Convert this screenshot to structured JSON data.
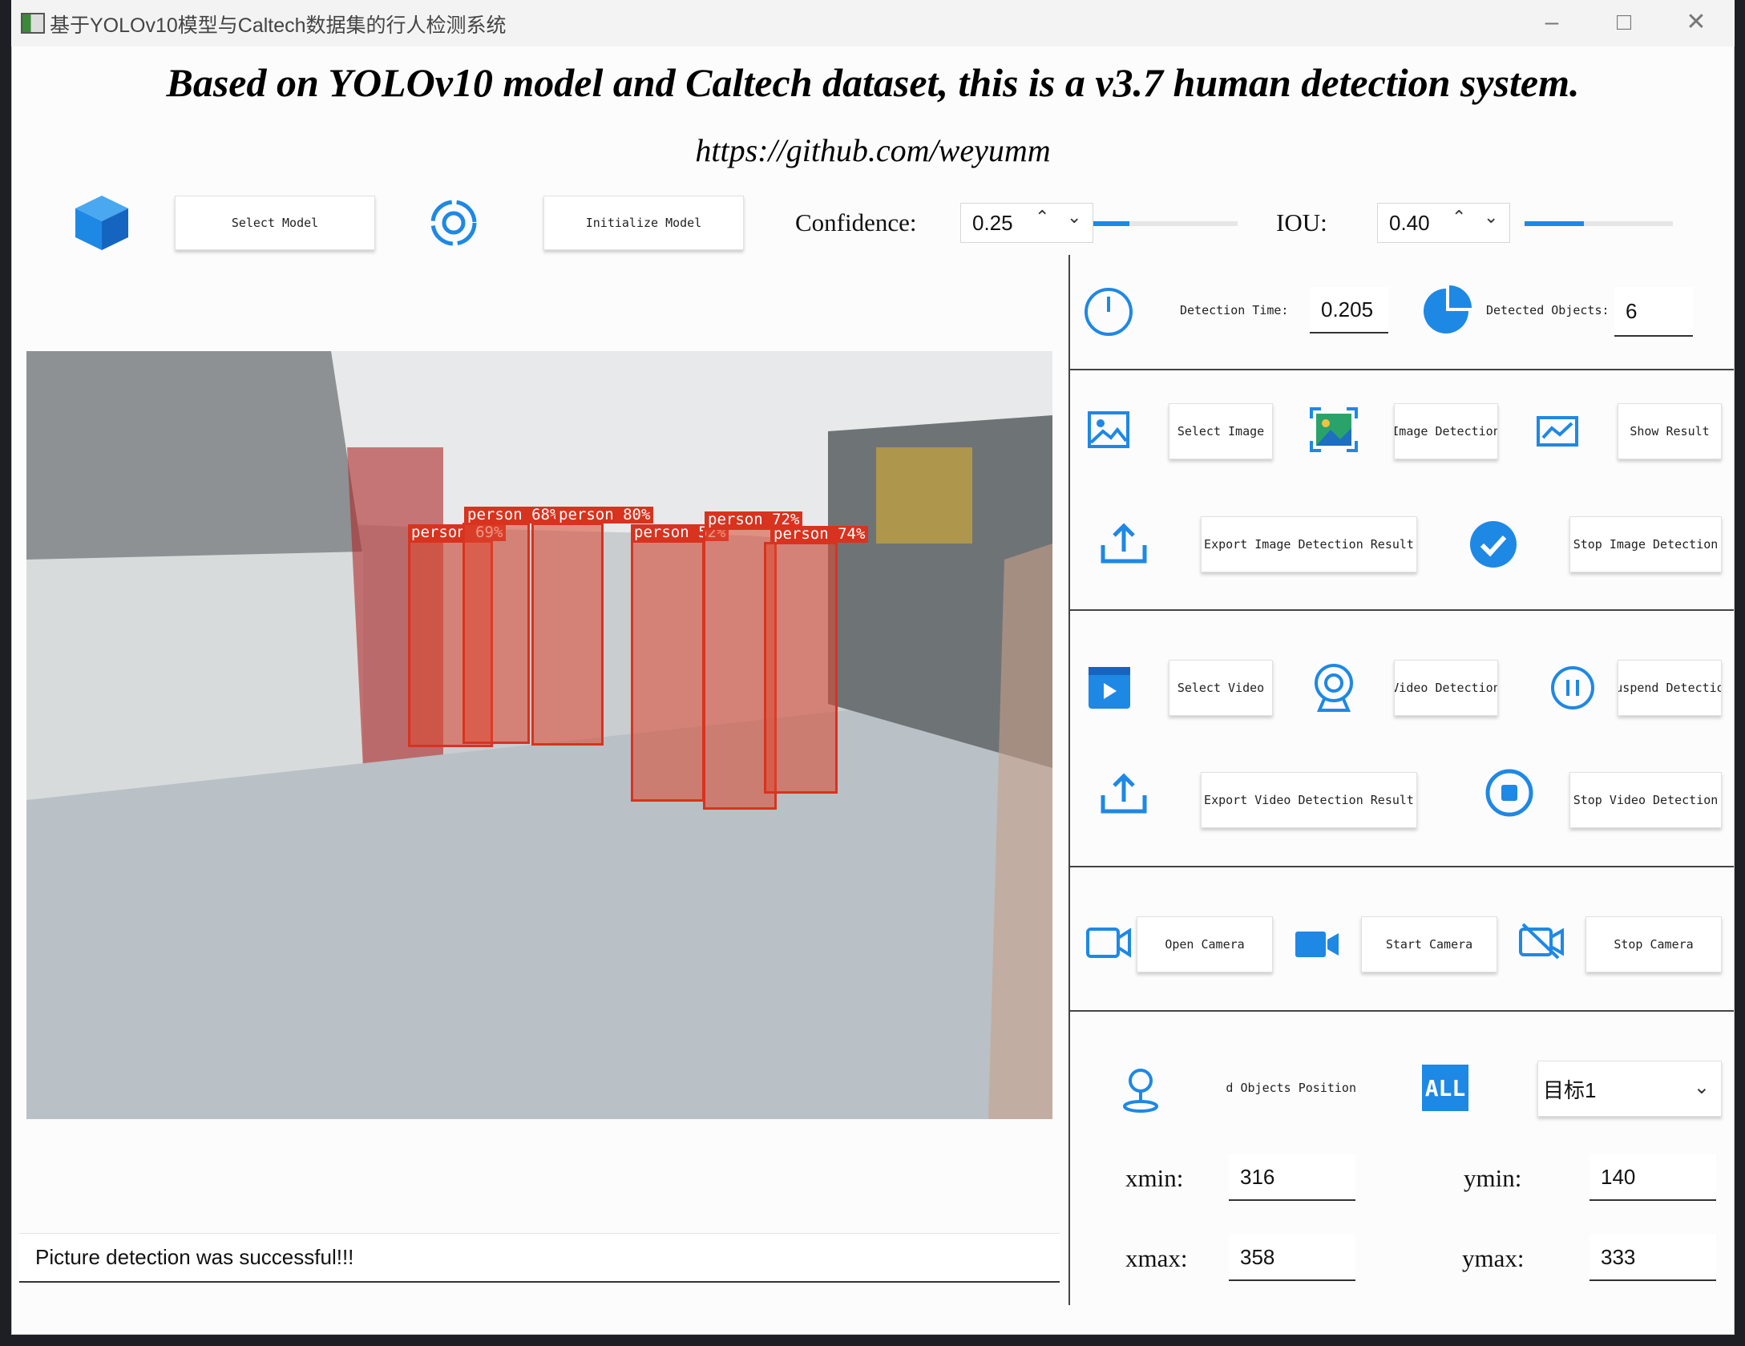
{
  "window": {
    "title": "基于YOLOv10模型与Caltech数据集的行人检测系统"
  },
  "header": {
    "title": "Based on YOLOv10 model and Caltech dataset, this is a v3.7 human detection system.",
    "url": "https://github.com/weyumm"
  },
  "toolbar": {
    "select_model": "Select Model",
    "init_model": "Initialize Model",
    "confidence_label": "Confidence:",
    "confidence_value": "0.25",
    "confidence_level": 0.25,
    "iou_label": "IOU:",
    "iou_value": "0.40",
    "iou_level": 0.4
  },
  "stats": {
    "time_label": "Detection Time:",
    "time_value": "0.205",
    "objects_label": "Detected Objects:",
    "objects_value": "6"
  },
  "image_section": {
    "select_image": "Select Image",
    "image_detection": "Image Detection",
    "show_result": "Show Result",
    "export_image": "Export Image Detection Result",
    "stop_image": "Stop Image Detection"
  },
  "video_section": {
    "select_video": "Select Video",
    "video_detection": "Video Detection",
    "suspend_detection": "Suspend Detection",
    "export_video": "Export Video Detection Result",
    "stop_video": "Stop Video Detection"
  },
  "camera_section": {
    "open_camera": "Open Camera",
    "start_camera": "Start Camera",
    "stop_camera": "Stop Camera"
  },
  "position": {
    "label": "Detected Objects Position",
    "all_badge": "ALL",
    "target_select": "目标1",
    "xmin_label": "xmin:",
    "xmin": "316",
    "ymin_label": "ymin:",
    "ymin": "140",
    "xmax_label": "xmax:",
    "xmax": "358",
    "ymax_label": "ymax:",
    "ymax": "333"
  },
  "status": {
    "message": "Picture detection was successful!!!"
  },
  "detections": [
    {
      "label": "person 69%"
    },
    {
      "label": "person 68%"
    },
    {
      "label": "person 80%"
    },
    {
      "label": "person 52%"
    },
    {
      "label": "person 72%"
    },
    {
      "label": "person 74%"
    }
  ],
  "colors": {
    "accent": "#1e88e5",
    "box": "#d8331f"
  }
}
